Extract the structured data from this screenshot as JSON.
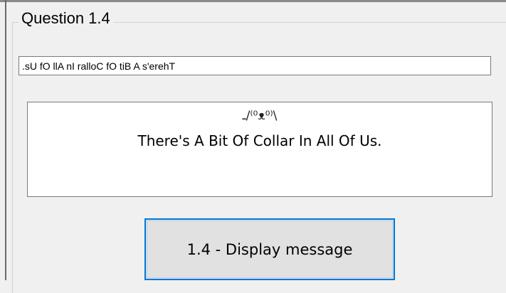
{
  "group": {
    "title": "Question 1.4"
  },
  "input": {
    "value": ".sU fO llA nI ralloC fO tiB A s'erehT"
  },
  "output": {
    "ascii_face": "ـ/⁽⁰ᴥ⁰⁾\\",
    "message": "There's A Bit Of Collar In All Of Us."
  },
  "button": {
    "label": "1.4 - Display message"
  },
  "colors": {
    "button_focus_border": "#0078d7",
    "window_bg": "#f0f0f0"
  }
}
